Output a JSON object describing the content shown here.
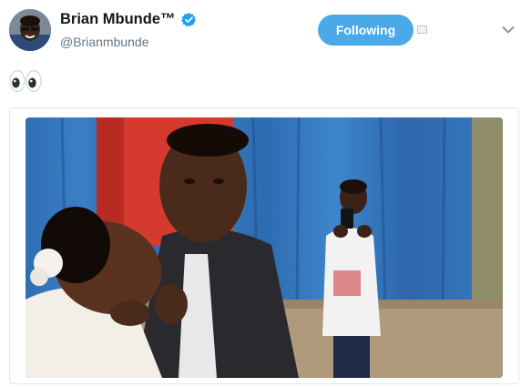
{
  "author": {
    "display_name": "Brian Mbunde™",
    "handle": "@Brianmbunde",
    "verified": true,
    "avatar_icon": "profile-photo"
  },
  "actions": {
    "follow_label": "Following",
    "more_icon": "chevron-down-icon"
  },
  "tweet": {
    "emoji": "👀"
  },
  "media": {
    "description_icon": "wedding-kiss-photo"
  },
  "colors": {
    "accent": "#4aa9e8",
    "verified": "#1da1f2",
    "secondary_text": "#657786"
  }
}
